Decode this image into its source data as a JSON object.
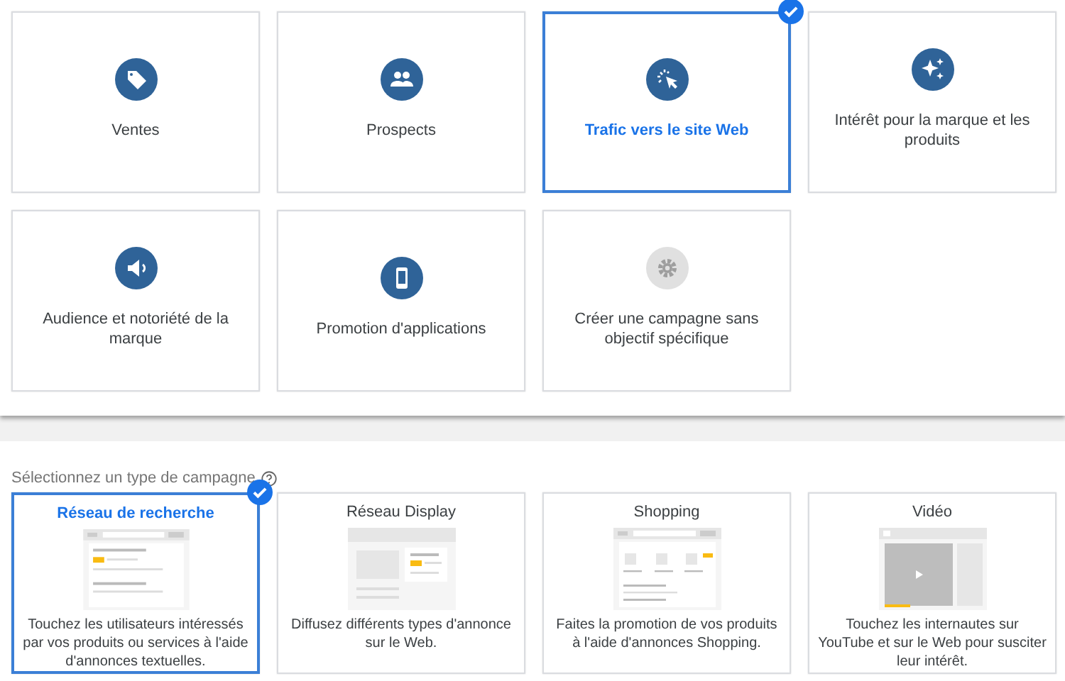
{
  "goals": [
    {
      "label": "Ventes",
      "selected": false
    },
    {
      "label": "Prospects",
      "selected": false
    },
    {
      "label": "Trafic vers le site Web",
      "selected": true
    },
    {
      "label": "Intérêt pour la marque et les produits",
      "selected": false
    },
    {
      "label": "Audience et notoriété de la marque",
      "selected": false
    },
    {
      "label": "Promotion d'applications",
      "selected": false
    },
    {
      "label": "Créer une campagne sans objectif spécifique",
      "selected": false
    }
  ],
  "campaign_types": {
    "heading": "Sélectionnez un type de campagne",
    "items": [
      {
        "title": "Réseau de recherche",
        "description": "Touchez les utilisateurs intéressés par vos produits ou services à l'aide d'annonces textuelles.",
        "selected": true
      },
      {
        "title": "Réseau Display",
        "description": "Diffusez différents types d'annonce sur le Web.",
        "selected": false
      },
      {
        "title": "Shopping",
        "description": "Faites la promotion de vos produits à l'aide d'annonces Shopping.",
        "selected": false
      },
      {
        "title": "Vidéo",
        "description": "Touchez les internautes sur YouTube et sur le Web pour susciter leur intérêt.",
        "selected": false
      }
    ]
  }
}
